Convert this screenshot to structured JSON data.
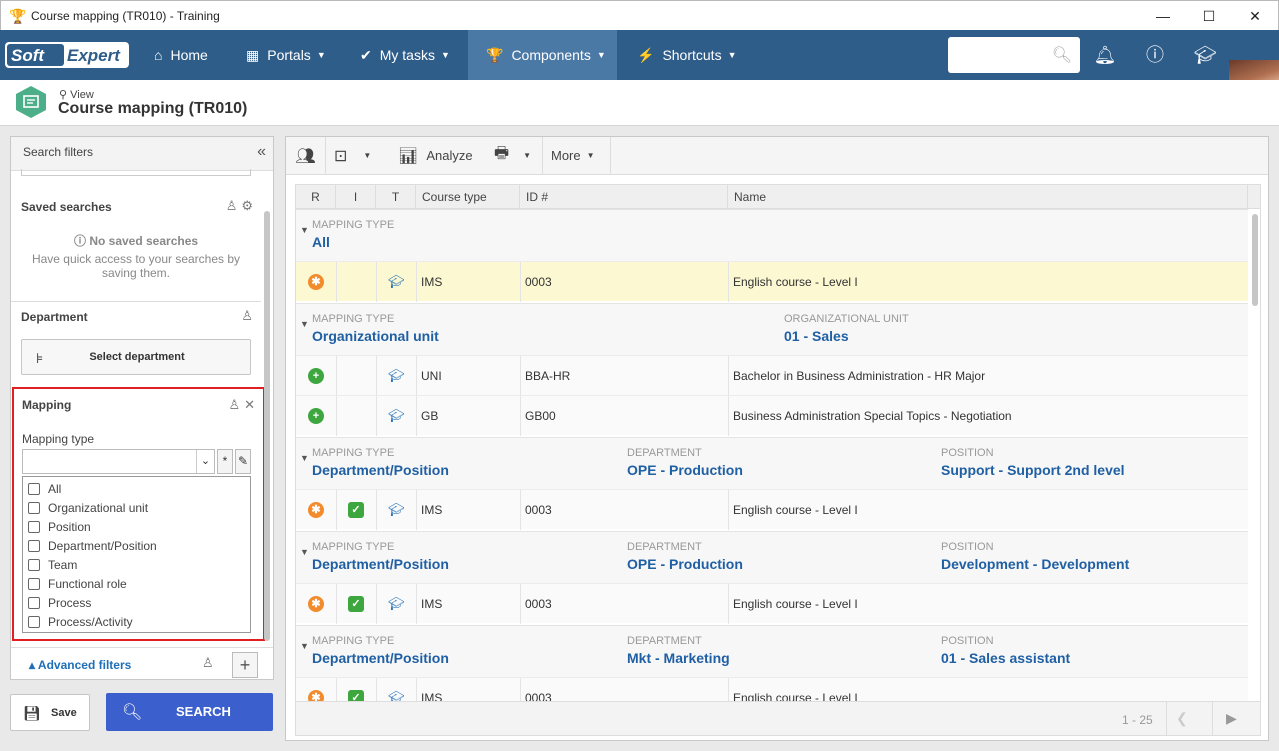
{
  "window": {
    "title": "Course mapping (TR010) - Training"
  },
  "nav": {
    "brand_left": "Soft",
    "brand_right": "Expert",
    "items": [
      {
        "label": "Home"
      },
      {
        "label": "Portals"
      },
      {
        "label": "My tasks"
      },
      {
        "label": "Components"
      },
      {
        "label": "Shortcuts"
      }
    ],
    "search_placeholder": ""
  },
  "header": {
    "mode": "View",
    "title": "Course mapping (TR010)"
  },
  "left": {
    "title": "Search filters",
    "saved_searches": {
      "title": "Saved searches",
      "empty_title": "No saved searches",
      "empty_line1": "Have quick access to your searches by",
      "empty_line2": "saving them."
    },
    "department": {
      "title": "Department",
      "button": "Select department"
    },
    "mapping": {
      "title": "Mapping",
      "field_label": "Mapping type",
      "options": [
        "All",
        "Organizational unit",
        "Position",
        "Department/Position",
        "Team",
        "Functional role",
        "Process",
        "Process/Activity"
      ]
    },
    "advanced_filters": "Advanced filters",
    "save": "Save",
    "search": "SEARCH"
  },
  "toolbar": {
    "analyze": "Analyze",
    "more": "More"
  },
  "grid": {
    "columns": [
      "R",
      "I",
      "T",
      "Course type",
      "ID #",
      "Name"
    ],
    "groups": [
      {
        "cols": [
          {
            "label": "MAPPING TYPE",
            "value": "All"
          }
        ],
        "rows": [
          {
            "r": "orange",
            "i": "",
            "type": "IMS",
            "id": "0003",
            "name": "English course - Level I"
          }
        ]
      },
      {
        "cols": [
          {
            "label": "MAPPING TYPE",
            "value": "Organizational unit"
          },
          {
            "label": "ORGANIZATIONAL UNIT",
            "value": "01 - Sales"
          }
        ],
        "rows": [
          {
            "r": "green",
            "i": "",
            "type": "UNI",
            "id": "BBA-HR",
            "name": "Bachelor in Business Administration - HR Major"
          },
          {
            "r": "green",
            "i": "",
            "type": "GB",
            "id": "GB00",
            "name": "Business Administration Special Topics - Negotiation"
          }
        ]
      },
      {
        "cols": [
          {
            "label": "MAPPING TYPE",
            "value": "Department/Position"
          },
          {
            "label": "DEPARTMENT",
            "value": "OPE - Production"
          },
          {
            "label": "POSITION",
            "value": "Support - Support 2nd level"
          }
        ],
        "rows": [
          {
            "r": "orange",
            "i": "check",
            "type": "IMS",
            "id": "0003",
            "name": "English course - Level I"
          }
        ]
      },
      {
        "cols": [
          {
            "label": "MAPPING TYPE",
            "value": "Department/Position"
          },
          {
            "label": "DEPARTMENT",
            "value": "OPE - Production"
          },
          {
            "label": "POSITION",
            "value": "Development - Development"
          }
        ],
        "rows": [
          {
            "r": "orange",
            "i": "check",
            "type": "IMS",
            "id": "0003",
            "name": "English course - Level I"
          }
        ]
      },
      {
        "cols": [
          {
            "label": "MAPPING TYPE",
            "value": "Department/Position"
          },
          {
            "label": "DEPARTMENT",
            "value": "Mkt - Marketing"
          },
          {
            "label": "POSITION",
            "value": "01 - Sales assistant"
          }
        ],
        "rows": [
          {
            "r": "orange",
            "i": "check",
            "type": "IMS",
            "id": "0003",
            "name": "English course - Level I"
          }
        ]
      }
    ],
    "pager": "1 - 25"
  }
}
